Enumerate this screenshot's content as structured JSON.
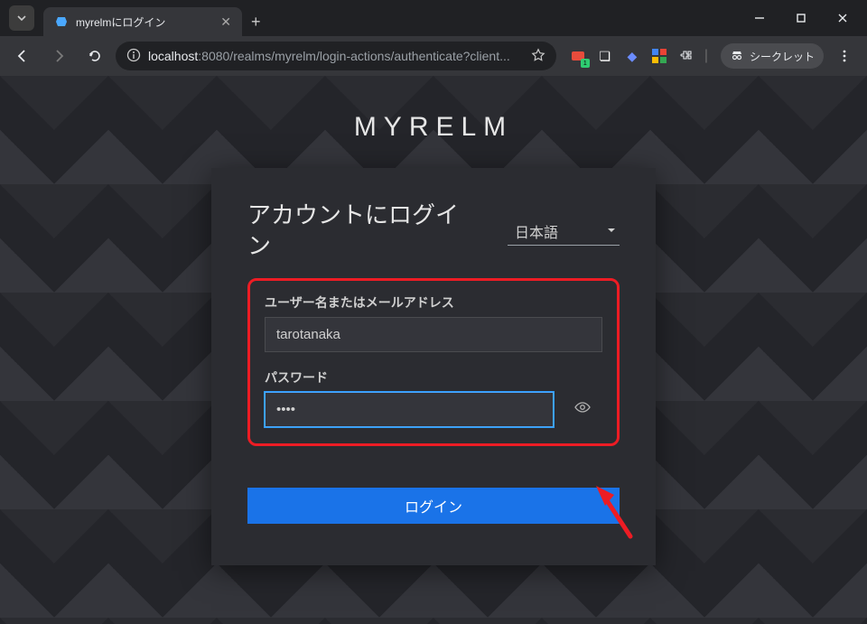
{
  "browser": {
    "tab_title": "myrelmにログイン",
    "url_prefix": "localhost",
    "url_rest": ":8080/realms/myrelm/login-actions/authenticate?client...",
    "incognito_label": "シークレット"
  },
  "page": {
    "realm_title": "MYRELM",
    "heading": "アカウントにログイン",
    "language": "日本語",
    "username_label": "ユーザー名またはメールアドレス",
    "username_value": "tarotanaka",
    "password_label": "パスワード",
    "password_value": "••••",
    "login_button": "ログイン"
  }
}
